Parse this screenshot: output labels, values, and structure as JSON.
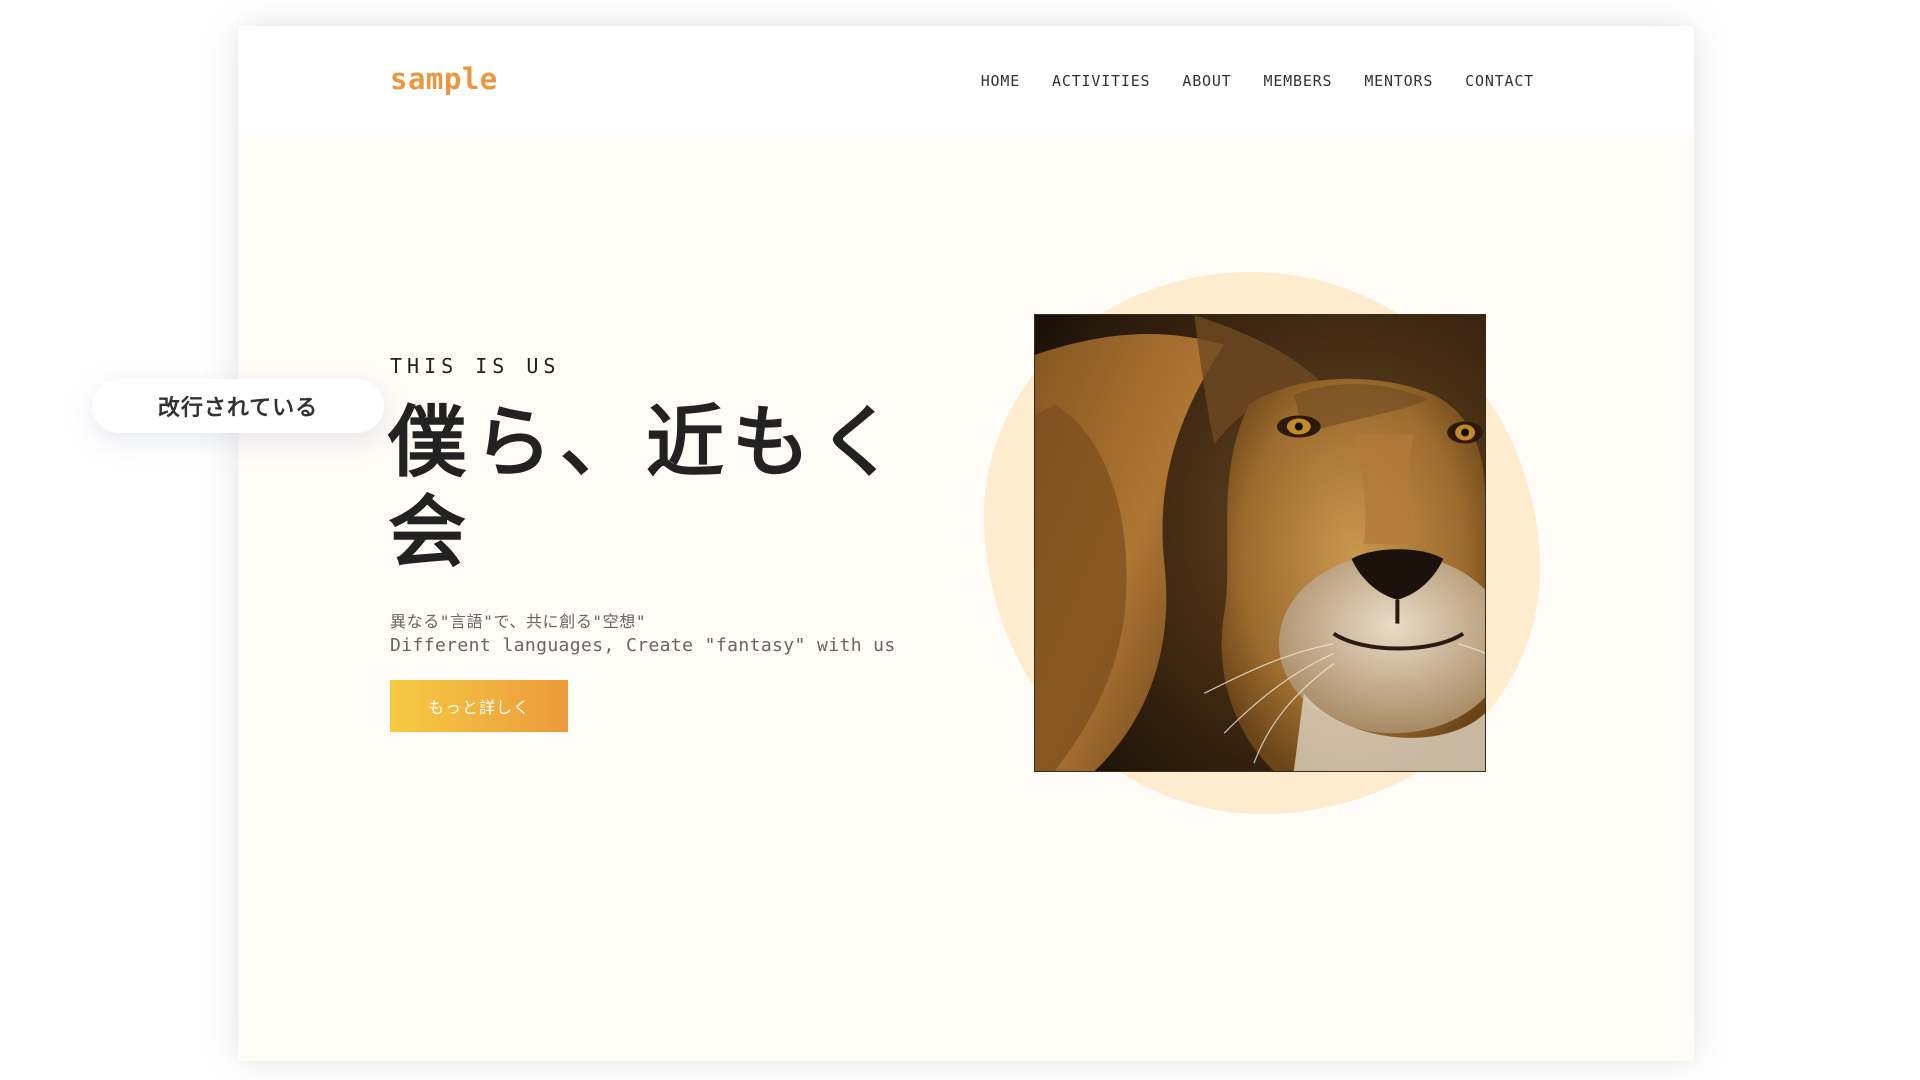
{
  "brand": {
    "logo_text": "sample",
    "accent_color": "#e99840"
  },
  "nav": {
    "items": [
      "HOME",
      "ACTIVITIES",
      "ABOUT",
      "MEMBERS",
      "MENTORS",
      "CONTACT"
    ]
  },
  "hero": {
    "eyebrow": "THIS IS US",
    "headline": "僕ら、近もく会",
    "subtitle_jp": "異なる\"言語\"で、共に創る\"空想\"",
    "subtitle_en": "Different languages, Create \"fantasy\" with us",
    "cta_label": "もっと詳しく",
    "cta_gradient": [
      "#f6cb43",
      "#ec9a3a"
    ],
    "blob_color": "#fdeccd",
    "image": "lion-face-photo"
  },
  "annotation": {
    "callout_text": "改行されている"
  }
}
